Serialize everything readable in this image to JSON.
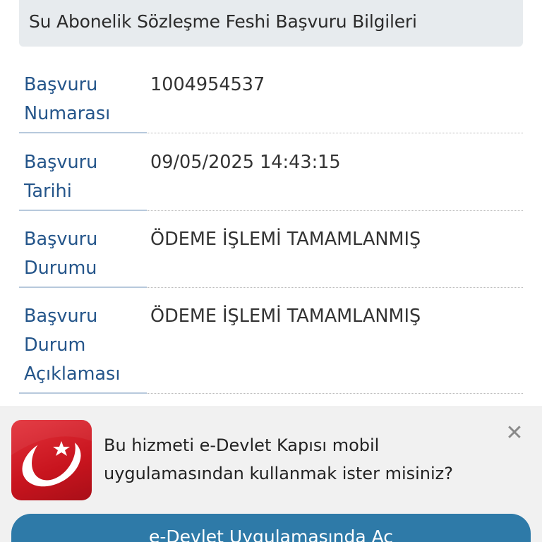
{
  "section": {
    "title": "Su Abonelik Sözleşme Feshi Başvuru Bilgileri"
  },
  "fields": [
    {
      "label_lines": [
        "Başvuru",
        "Numarası"
      ],
      "value": "1004954537"
    },
    {
      "label_lines": [
        "Başvuru",
        "Tarihi"
      ],
      "value": "09/05/2025 14:43:15"
    },
    {
      "label_lines": [
        "Başvuru",
        "Durumu"
      ],
      "value": "ÖDEME İŞLEMİ TAMAMLANMIŞ"
    },
    {
      "label_lines": [
        "Başvuru",
        "Durum",
        "Açıklaması"
      ],
      "value": "ÖDEME İŞLEMİ TAMAMLANMIŞ"
    }
  ],
  "app_banner": {
    "icon": "e-devlet-logo-icon",
    "message_line1": "Bu hizmeti e-Devlet Kapısı mobil",
    "message_line2": "uygulamasından kullanmak ister misiniz?",
    "close_icon": "close-icon",
    "close_symbol": "✕",
    "open_button_label": "e-Devlet Uygulamasında Aç"
  },
  "colors": {
    "label": "#24558a",
    "header_bg": "#e7ebee",
    "banner_bg": "#f1f1f1",
    "button_bg": "#2e7aa8",
    "icon_red": "#d6222b"
  }
}
